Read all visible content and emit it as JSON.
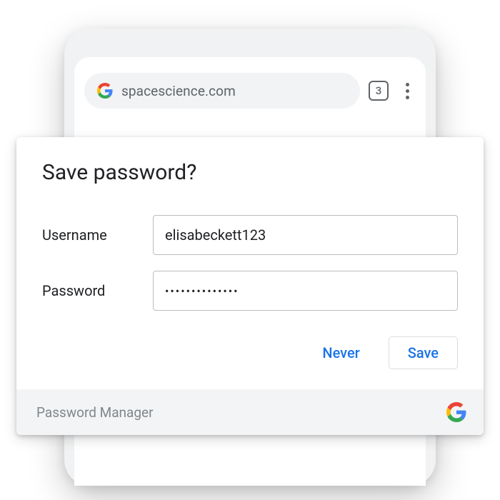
{
  "browser": {
    "url": "spacescience.com",
    "tab_count": "3"
  },
  "dialog": {
    "title": "Save password?",
    "username_label": "Username",
    "username_value": "elisabeckett123",
    "password_label": "Password",
    "password_value": "••••••••••••••",
    "never_label": "Never",
    "save_label": "Save"
  },
  "footer": {
    "label": "Password Manager"
  }
}
